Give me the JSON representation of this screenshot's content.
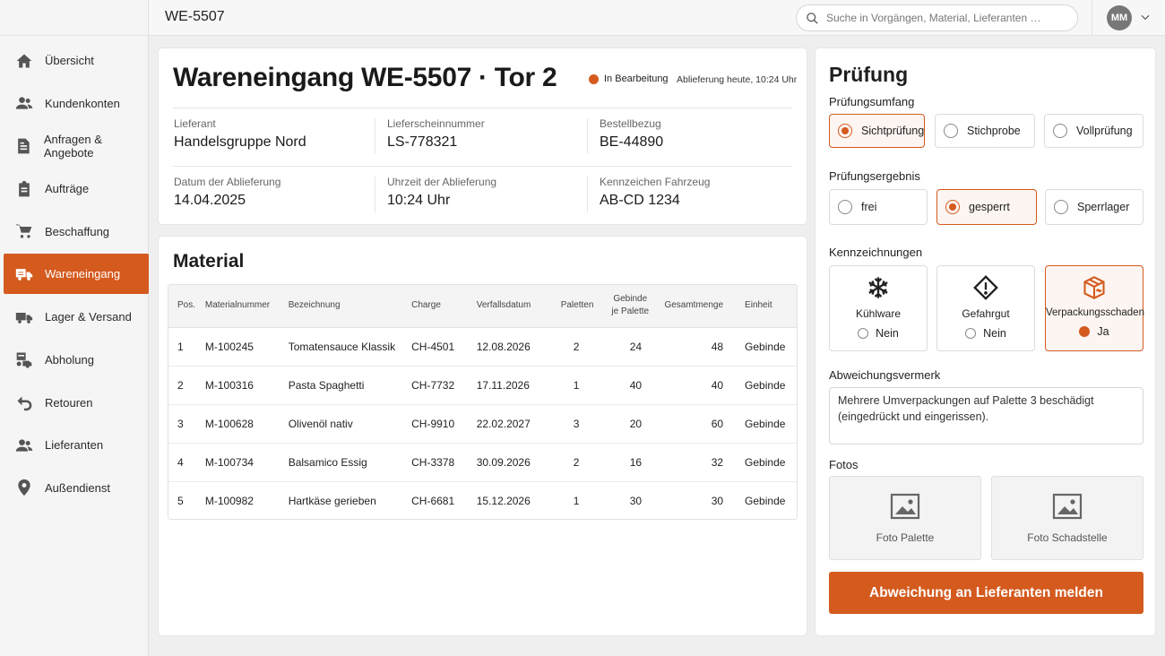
{
  "header": {
    "title": "WE-5507",
    "search_placeholder": "Suche in Vorgängen, Material, Lieferanten …",
    "user_initials": "MM"
  },
  "sidebar": {
    "items": [
      {
        "label": "Übersicht",
        "icon": "home-icon",
        "active": false
      },
      {
        "label": "Kundenkonten",
        "icon": "users-icon",
        "active": false
      },
      {
        "label": "Anfragen & Angebote",
        "icon": "document-icon",
        "active": false
      },
      {
        "label": "Aufträge",
        "icon": "clipboard-icon",
        "active": false
      },
      {
        "label": "Beschaffung",
        "icon": "cart-icon",
        "active": false
      },
      {
        "label": "Wareneingang",
        "icon": "truck-icon",
        "active": true
      },
      {
        "label": "Lager & Versand",
        "icon": "warehouse-truck-icon",
        "active": false
      },
      {
        "label": "Abholung",
        "icon": "pickup-icon",
        "active": false
      },
      {
        "label": "Retouren",
        "icon": "return-icon",
        "active": false
      },
      {
        "label": "Lieferanten",
        "icon": "supplier-icon",
        "active": false
      },
      {
        "label": "Außendienst",
        "icon": "location-pin-icon",
        "active": false
      }
    ]
  },
  "receipt": {
    "title": "Wareneingang WE-5507 · Tor 2",
    "status": "In Bearbeitung",
    "status_color": "#d45a1e",
    "delivery_note": "Ablieferung heute, 10:24 Uhr",
    "fields": {
      "lieferant": {
        "label": "Lieferant",
        "value": "Handelsgruppe Nord"
      },
      "lieferschein": {
        "label": "Lieferscheinnummer",
        "value": "LS-778321"
      },
      "bestellbezug": {
        "label": "Bestellbezug",
        "value": "BE-44890"
      },
      "datum": {
        "label": "Datum der Ablieferung",
        "value": "14.04.2025"
      },
      "uhrzeit": {
        "label": "Uhrzeit der Ablieferung",
        "value": "10:24 Uhr"
      },
      "kennzeichen": {
        "label": "Kennzeichen Fahrzeug",
        "value": "AB-CD 1234"
      }
    }
  },
  "material": {
    "title": "Material",
    "columns": {
      "pos": "Pos.",
      "nr": "Materialnummer",
      "bez": "Bezeichnung",
      "charge": "Charge",
      "verfall": "Verfallsdatum",
      "paletten": "Paletten",
      "gebinde_1": "Gebinde",
      "gebinde_2": "je Palette",
      "gesamt": "Gesamtmenge",
      "einheit": "Einheit"
    },
    "rows": [
      {
        "pos": "1",
        "nr": "M-100245",
        "bez": "Tomatensauce Klassik",
        "charge": "CH-4501",
        "verfall": "12.08.2026",
        "paletten": "2",
        "gebinde": "24",
        "gesamt": "48",
        "einheit": "Gebinde"
      },
      {
        "pos": "2",
        "nr": "M-100316",
        "bez": "Pasta Spaghetti",
        "charge": "CH-7732",
        "verfall": "17.11.2026",
        "paletten": "1",
        "gebinde": "40",
        "gesamt": "40",
        "einheit": "Gebinde"
      },
      {
        "pos": "3",
        "nr": "M-100628",
        "bez": "Olivenöl nativ",
        "charge": "CH-9910",
        "verfall": "22.02.2027",
        "paletten": "3",
        "gebinde": "20",
        "gesamt": "60",
        "einheit": "Gebinde"
      },
      {
        "pos": "4",
        "nr": "M-100734",
        "bez": "Balsamico Essig",
        "charge": "CH-3378",
        "verfall": "30.09.2026",
        "paletten": "2",
        "gebinde": "16",
        "gesamt": "32",
        "einheit": "Gebinde"
      },
      {
        "pos": "5",
        "nr": "M-100982",
        "bez": "Hartkäse gerieben",
        "charge": "CH-6681",
        "verfall": "15.12.2026",
        "paletten": "1",
        "gebinde": "30",
        "gesamt": "30",
        "einheit": "Gebinde"
      }
    ]
  },
  "pruefung": {
    "title": "Prüfung",
    "umfang_label": "Prüfungsumfang",
    "umfang_options": [
      "Sichtprüfung",
      "Stichprobe",
      "Vollprüfung"
    ],
    "umfang_selected": "Sichtprüfung",
    "ergebnis_label": "Prüfungsergebnis",
    "ergebnis_options": [
      "frei",
      "gesperrt",
      "Sperrlager"
    ],
    "ergebnis_selected": "gesperrt",
    "kennzeichnungen_label": "Kennzeichnungen",
    "kennzeichnungen": [
      {
        "label": "Kühlware",
        "value": "Nein",
        "icon": "snowflake-icon",
        "selected": false
      },
      {
        "label": "Gefahrgut",
        "value": "Nein",
        "icon": "hazard-icon",
        "selected": false
      },
      {
        "label": "Verpackungsschaden",
        "value": "Ja",
        "icon": "package-damage-icon",
        "selected": true
      }
    ],
    "abweichung_label": "Abweichungsvermerk",
    "abweichung_text": "Mehrere Umverpackungen auf Palette 3 beschädigt (eingedrückt und eingerissen).",
    "fotos_label": "Fotos",
    "fotos": [
      "Foto Palette",
      "Foto Schadstelle"
    ],
    "report_button": "Abweichung an Lieferanten melden",
    "accent": "#d45a1e"
  }
}
